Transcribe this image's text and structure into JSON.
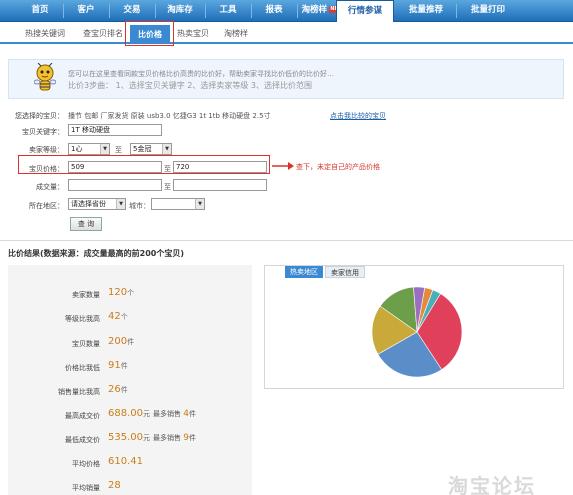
{
  "topnav": {
    "items": [
      "首页",
      "客户",
      "交易",
      "淘库存",
      "工具",
      "报表",
      "淘榜样",
      "行情参谋",
      "批量推荐",
      "批量打印"
    ],
    "new_badge": "NEW",
    "active_index": 7
  },
  "subnav": {
    "items": [
      "热搜关键词",
      "查宝贝排名",
      "比价格",
      "热卖宝贝",
      "淘榜样"
    ],
    "active_index": 2
  },
  "banner": {
    "line1": "您可以在这里查看同款宝贝价格比价高贵的比价好，帮助卖家寻找比价低价的比价好…",
    "line2": "比价3步曲： 1、选择宝贝关键字 2、选择卖家等级 3、选择比价范围"
  },
  "form": {
    "selected_item_label": "您选择的宝贝：",
    "selected_item_value": "播节 包邮 厂家发货 原装 usb3.0 忆捷G3 1t 1tb 移动硬盘 2.5寸",
    "change_link": "点击我比较的宝贝",
    "keyword_label": "宝贝关键字：",
    "keyword_value": "1T 移动硬盘",
    "level_label": "卖家等级：",
    "level_from": "1心",
    "level_to_sep": "至",
    "level_to": "5金冠",
    "price_label": "宝贝价格：",
    "price_from": "509",
    "price_to_sep": "至",
    "price_to": "720",
    "price_note": "查下，未定自己的产品价格",
    "sales_label": "成交量：",
    "sales_from": "",
    "sales_to_sep": "至",
    "sales_to": "",
    "region_label": "所在地区：",
    "province_placeholder": "请选择省份",
    "city_label": "城市：",
    "city_value": "",
    "query_button": "查 询"
  },
  "results": {
    "title": "比价结果(数据来源：成交量最高的前200个宝贝)",
    "rows": [
      {
        "label": "卖家数量",
        "value": "120",
        "unit": "个"
      },
      {
        "label": "等级比我高",
        "value": "42",
        "unit": "个"
      },
      {
        "label": "宝贝数量",
        "value": "200",
        "unit": "件"
      },
      {
        "label": "价格比我低",
        "value": "91",
        "unit": "件"
      },
      {
        "label": "销售量比我高",
        "value": "26",
        "unit": "件"
      },
      {
        "label": "最高成交价",
        "value": "688.00",
        "unit": "元",
        "extra_label": "最多销售",
        "extra_value": "4",
        "extra_unit": "件"
      },
      {
        "label": "最低成交价",
        "value": "535.00",
        "unit": "元",
        "extra_label": "最多销售",
        "extra_value": "9",
        "extra_unit": "件"
      },
      {
        "label": "平均价格",
        "value": "610.41",
        "unit": ""
      },
      {
        "label": "平均销量",
        "value": "28",
        "unit": ""
      }
    ]
  },
  "chart": {
    "tabs": [
      "热卖地区",
      "卖家信用"
    ],
    "active_tab": 0,
    "slices": [
      {
        "value": 32,
        "color": "#e0405a"
      },
      {
        "value": 26,
        "color": "#5b8ec9"
      },
      {
        "value": 18,
        "color": "#c9a93a"
      },
      {
        "value": 14,
        "color": "#6d9e4a"
      },
      {
        "value": 4,
        "color": "#9b6fc0"
      },
      {
        "value": 3,
        "color": "#e48a3a"
      },
      {
        "value": 3,
        "color": "#49b0b8"
      }
    ]
  },
  "watermark": "淘宝论坛"
}
